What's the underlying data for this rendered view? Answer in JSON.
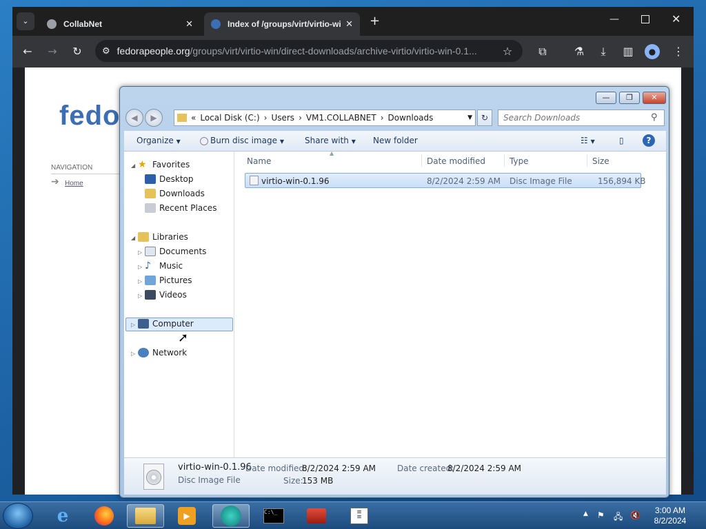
{
  "browser": {
    "tabs": [
      {
        "label": "CollabNet",
        "active": false
      },
      {
        "label": "Index of /groups/virt/virtio-wi",
        "active": true
      }
    ],
    "new_tab": "+",
    "url_host": "fedorapeople.org",
    "url_path": "/groups/virt/virtio-win/direct-downloads/archive-virtio/virtio-win-0.1...",
    "page": {
      "logo_text": "fedor",
      "nav_heading": "NAVIGATION",
      "nav_home": "Home"
    },
    "icons": {
      "back": "back-arrow-icon",
      "forward": "forward-arrow-icon",
      "reload": "reload-icon",
      "site_info": "site-info-icon",
      "bookmark": "star-icon",
      "extensions": "puzzle-icon",
      "labs": "flask-icon",
      "downloads": "download-icon",
      "sidepanel": "side-panel-icon",
      "profile": "profile-icon",
      "menu": "kebab-menu-icon"
    }
  },
  "explorer": {
    "breadcrumb": [
      "Local Disk (C:)",
      "Users",
      "VM1.COLLABNET",
      "Downloads"
    ],
    "search_placeholder": "Search Downloads",
    "commands": {
      "organize": "Organize",
      "burn": "Burn disc image",
      "share": "Share with",
      "new_folder": "New folder"
    },
    "nav_tree": {
      "favorites": "Favorites",
      "favorites_items": [
        "Desktop",
        "Downloads",
        "Recent Places"
      ],
      "libraries": "Libraries",
      "libraries_items": [
        "Documents",
        "Music",
        "Pictures",
        "Videos"
      ],
      "computer": "Computer",
      "network": "Network"
    },
    "columns": {
      "name": "Name",
      "date": "Date modified",
      "type": "Type",
      "size": "Size"
    },
    "files": [
      {
        "name": "virtio-win-0.1.96",
        "date": "8/2/2024 2:59 AM",
        "type": "Disc Image File",
        "size": "156,894 KB"
      }
    ],
    "details": {
      "name": "virtio-win-0.1.96",
      "type": "Disc Image File",
      "modified_label": "Date modified:",
      "modified": "8/2/2024 2:59 AM",
      "created_label": "Date created:",
      "created": "8/2/2024 2:59 AM",
      "size_label": "Size:",
      "size": "153 MB"
    }
  },
  "taskbar": {
    "time": "3:00 AM",
    "date": "8/2/2024",
    "apps": [
      "start-orb-icon",
      "internet-explorer-icon",
      "firefox-icon",
      "file-explorer-icon",
      "media-player-icon",
      "remote-app-icon",
      "command-prompt-icon",
      "toolbox-icon",
      "notepad-icon"
    ],
    "accent": "#1d4b7e"
  }
}
